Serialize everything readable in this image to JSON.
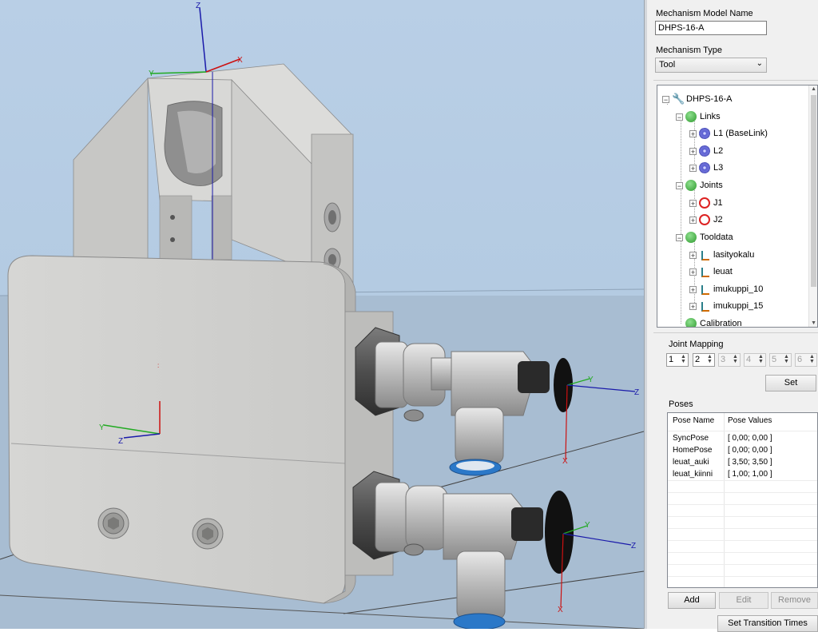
{
  "viewport": {
    "axis_labels": {
      "x": "X",
      "y": "Y",
      "z": "Z"
    },
    "colors": {
      "sky": "#b7cde3",
      "floor": "#a9bdd0",
      "metal": "#d5d5d3",
      "x_axis": "#cc1111",
      "y_axis": "#22aa22",
      "z_axis": "#1a1aaa"
    }
  },
  "panel": {
    "model_name_label": "Mechanism Model Name",
    "model_name_value": "DHPS-16-A",
    "type_label": "Mechanism Type",
    "type_value": "Tool",
    "tree": {
      "root": "DHPS-16-A",
      "links_label": "Links",
      "links": [
        "L1 (BaseLink)",
        "L2",
        "L3"
      ],
      "joints_label": "Joints",
      "joints": [
        "J1",
        "J2"
      ],
      "tooldata_label": "Tooldata",
      "tooldata": [
        "lasityokalu",
        "leuat",
        "imukuppi_10",
        "imukuppi_15"
      ],
      "calibration_label": "Calibration"
    },
    "joint_mapping_label": "Joint Mapping",
    "joint_mapping_values": [
      "1",
      "2",
      "3",
      "4",
      "5",
      "6"
    ],
    "set_button": "Set",
    "poses_label": "Poses",
    "poses_columns": [
      "Pose Name",
      "Pose Values"
    ],
    "poses": [
      {
        "name": "SyncPose",
        "values": "[ 0,00; 0,00 ]"
      },
      {
        "name": "HomePose",
        "values": "[ 0,00; 0,00 ]"
      },
      {
        "name": "leuat_auki",
        "values": "[ 3,50; 3,50 ]"
      },
      {
        "name": "leuat_kiinni",
        "values": "[ 1,00; 1,00 ]"
      }
    ],
    "add_button": "Add",
    "edit_button": "Edit",
    "remove_button": "Remove",
    "set_transition_button": "Set Transition Times"
  }
}
